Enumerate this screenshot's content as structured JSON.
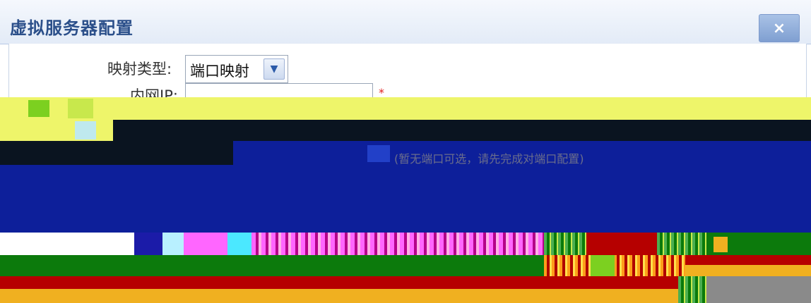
{
  "dialog": {
    "title": "虚拟服务器配置",
    "close_label": "×"
  },
  "form": {
    "mapping_type_label": "映射类型:",
    "mapping_type_value": "端口映射",
    "lan_ip_label": "内网IP:",
    "lan_ip_value": "",
    "required_mark": "*"
  },
  "notice": {
    "text": "(暂无端口可选，请先完成对端口配置)"
  },
  "colors": {
    "title": "#2b4f8a",
    "corrupt_navy": "#0d1f9a",
    "corrupt_yellow": "#eef56a",
    "corrupt_green": "#0c7a0c",
    "corrupt_red": "#b60000",
    "corrupt_orange": "#f0b020"
  }
}
